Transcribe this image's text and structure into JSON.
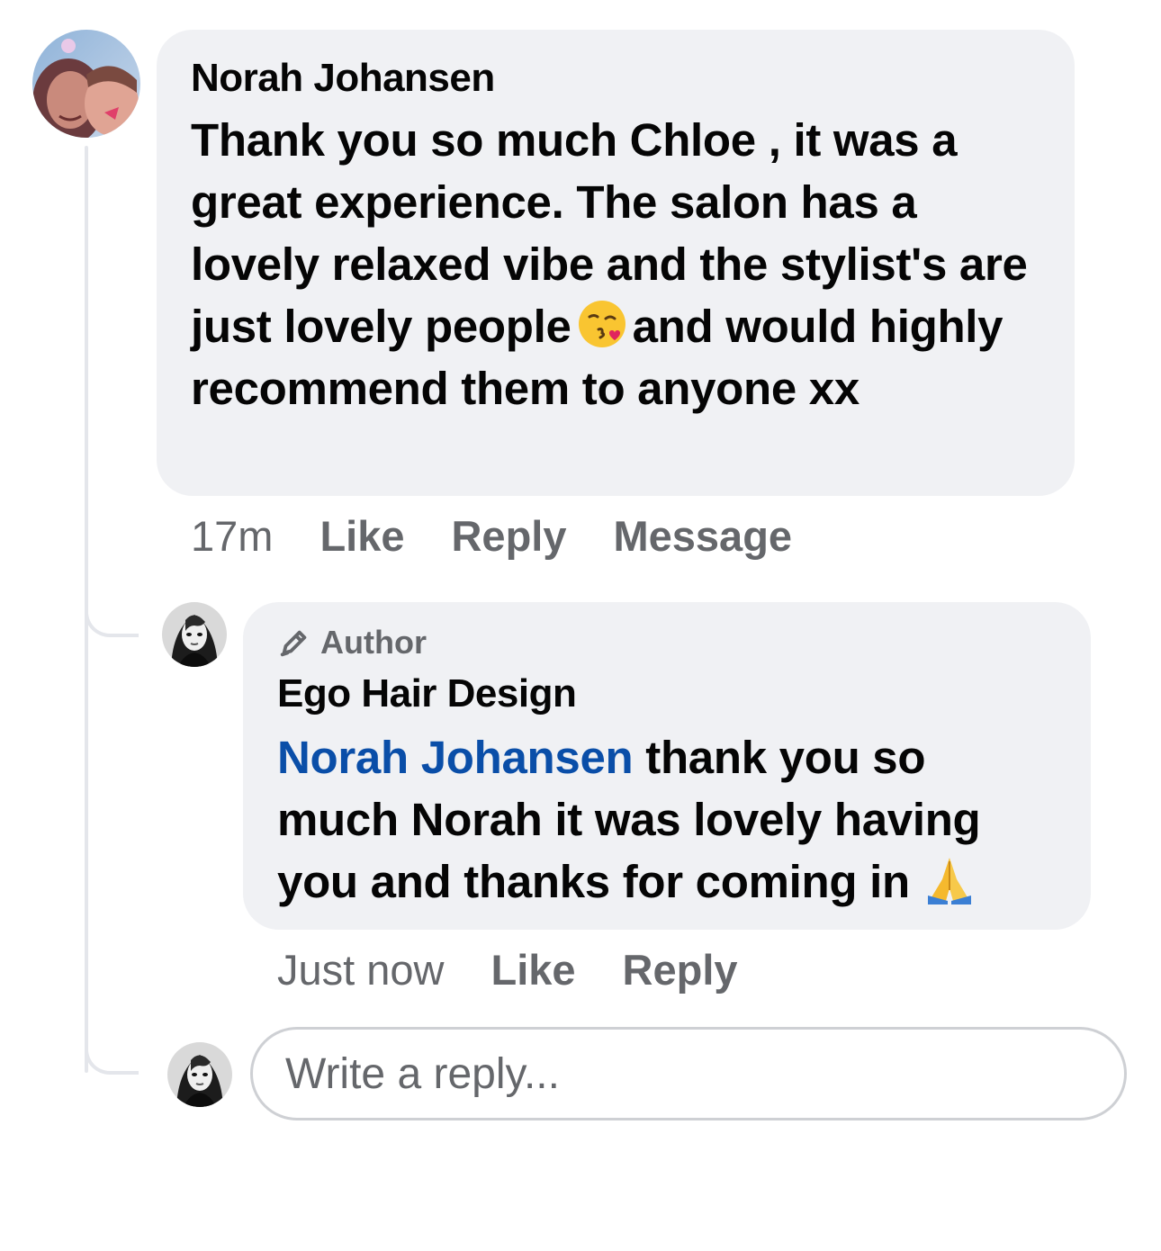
{
  "comment": {
    "author": "Norah Johansen",
    "text_before_emoji": "Thank you so much Chloe , it was a great experience. The salon has a lovely relaxed vibe and the stylist's are just lovely people",
    "emoji": "kissing-face-emoji",
    "text_after_emoji": "and would highly recommend them to anyone xx",
    "time": "17m",
    "like": "Like",
    "reply": "Reply",
    "message": "Message"
  },
  "reply": {
    "badge": "Author",
    "author": "Ego Hair Design",
    "mention": "Norah Johansen",
    "text": "thank you so much Norah it was lovely having you and thanks for coming in",
    "emoji": "folded-hands-emoji",
    "time": "Just now",
    "like": "Like",
    "reply": "Reply"
  },
  "composer": {
    "placeholder": "Write a reply..."
  },
  "colors": {
    "bubble": "#f0f1f4",
    "muted": "#65676b",
    "mention": "#0a4ea8",
    "thread_line": "#e4e6eb"
  }
}
